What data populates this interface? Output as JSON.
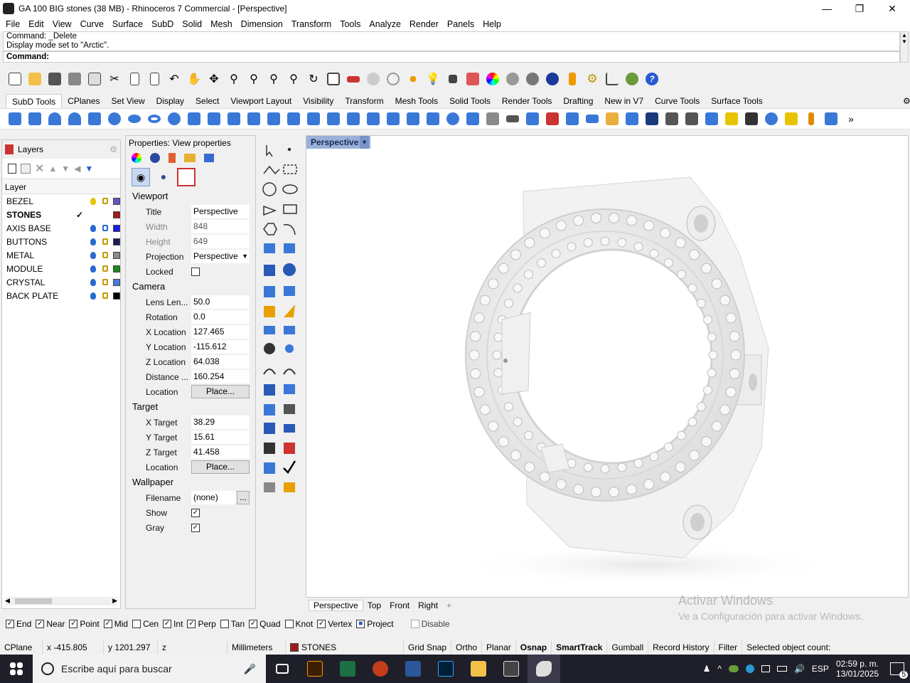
{
  "window": {
    "title": "GA 100 BIG stones (38 MB) - Rhinoceros 7 Commercial - [Perspective]"
  },
  "menu": [
    "File",
    "Edit",
    "View",
    "Curve",
    "Surface",
    "SubD",
    "Solid",
    "Mesh",
    "Dimension",
    "Transform",
    "Tools",
    "Analyze",
    "Render",
    "Panels",
    "Help"
  ],
  "command": {
    "history1": "Command: _Delete",
    "history2": "Display mode set to \"Arctic\".",
    "prompt": "Command:"
  },
  "toolbar_tabs": [
    "SubD Tools",
    "CPlanes",
    "Set View",
    "Display",
    "Select",
    "Viewport Layout",
    "Visibility",
    "Transform",
    "Mesh Tools",
    "Solid Tools",
    "Render Tools",
    "Drafting",
    "New in V7",
    "Curve Tools",
    "Surface Tools"
  ],
  "layers": {
    "title": "Layers",
    "column_header": "Layer",
    "items": [
      {
        "name": "BEZEL",
        "current": "",
        "color": "#6a4fc7",
        "bulb": "#e8c400"
      },
      {
        "name": "STONES",
        "current": "✓",
        "color": "#a01a1a",
        "bulb": ""
      },
      {
        "name": "AXIS BASE",
        "current": "",
        "color": "#1a1ae0",
        "bulb": "#2a6ad0"
      },
      {
        "name": "BUTTONS",
        "current": "",
        "color": "#1a1a5a",
        "bulb": "#2a6ad0"
      },
      {
        "name": "METAL",
        "current": "",
        "color": "#8a8a8a",
        "bulb": "#2a6ad0"
      },
      {
        "name": "MODULE",
        "current": "",
        "color": "#1a8a1a",
        "bulb": "#2a6ad0"
      },
      {
        "name": "CRYSTAL",
        "current": "",
        "color": "#4a7ae0",
        "bulb": "#2a6ad0"
      },
      {
        "name": "BACK PLATE",
        "current": "",
        "color": "#000000",
        "bulb": "#2a6ad0"
      }
    ]
  },
  "properties": {
    "title": "Properties: View properties",
    "viewport": {
      "section": "Viewport",
      "title_label": "Title",
      "title_value": "Perspective",
      "width_label": "Width",
      "width_value": "848",
      "height_label": "Height",
      "height_value": "649",
      "projection_label": "Projection",
      "projection_value": "Perspective",
      "locked_label": "Locked"
    },
    "camera": {
      "section": "Camera",
      "lens_label": "Lens Len...",
      "lens_value": "50.0",
      "rotation_label": "Rotation",
      "rotation_value": "0.0",
      "x_label": "X Location",
      "x_value": "127.465",
      "y_label": "Y Location",
      "y_value": "-115.612",
      "z_label": "Z Location",
      "z_value": "64.038",
      "distance_label": "Distance ...",
      "distance_value": "160.254",
      "location_label": "Location",
      "place_button": "Place..."
    },
    "target": {
      "section": "Target",
      "x_label": "X Target",
      "x_value": "38.29",
      "y_label": "Y Target",
      "y_value": "15.61",
      "z_label": "Z Target",
      "z_value": "41.458",
      "location_label": "Location",
      "place_button": "Place..."
    },
    "wallpaper": {
      "section": "Wallpaper",
      "filename_label": "Filename",
      "filename_value": "(none)",
      "browse": "...",
      "show_label": "Show",
      "gray_label": "Gray"
    }
  },
  "viewport": {
    "active_tab": "Perspective",
    "tabs": [
      "Perspective",
      "Top",
      "Front",
      "Right"
    ],
    "add_tab": "+"
  },
  "osnap": {
    "items": [
      {
        "label": "End",
        "checked": "✓"
      },
      {
        "label": "Near",
        "checked": "✓"
      },
      {
        "label": "Point",
        "checked": "✓"
      },
      {
        "label": "Mid",
        "checked": "✓"
      },
      {
        "label": "Cen",
        "checked": ""
      },
      {
        "label": "Int",
        "checked": "✓"
      },
      {
        "label": "Perp",
        "checked": "✓"
      },
      {
        "label": "Tan",
        "checked": ""
      },
      {
        "label": "Quad",
        "checked": "✓"
      },
      {
        "label": "Knot",
        "checked": ""
      },
      {
        "label": "Vertex",
        "checked": "✓"
      },
      {
        "label": "Project",
        "checked": "■"
      },
      {
        "label": "Disable",
        "checked": ""
      }
    ]
  },
  "status": {
    "cplane": "CPlane",
    "x": "x -415.805",
    "y": "y 1201.297",
    "z": "z",
    "units": "Millimeters",
    "layer": "STONES",
    "toggles": [
      "Grid Snap",
      "Ortho",
      "Planar",
      "Osnap",
      "SmartTrack",
      "Gumball",
      "Record History",
      "Filter"
    ],
    "selected": "Selected object count:"
  },
  "watermark": {
    "line1": "Activar Windows",
    "line2": "Ve a Configuración para activar Windows."
  },
  "taskbar": {
    "search_placeholder": "Escribe aquí para buscar",
    "lang": "ESP",
    "time": "02:59 p. m.",
    "date": "13/01/2025",
    "notif": "5"
  }
}
